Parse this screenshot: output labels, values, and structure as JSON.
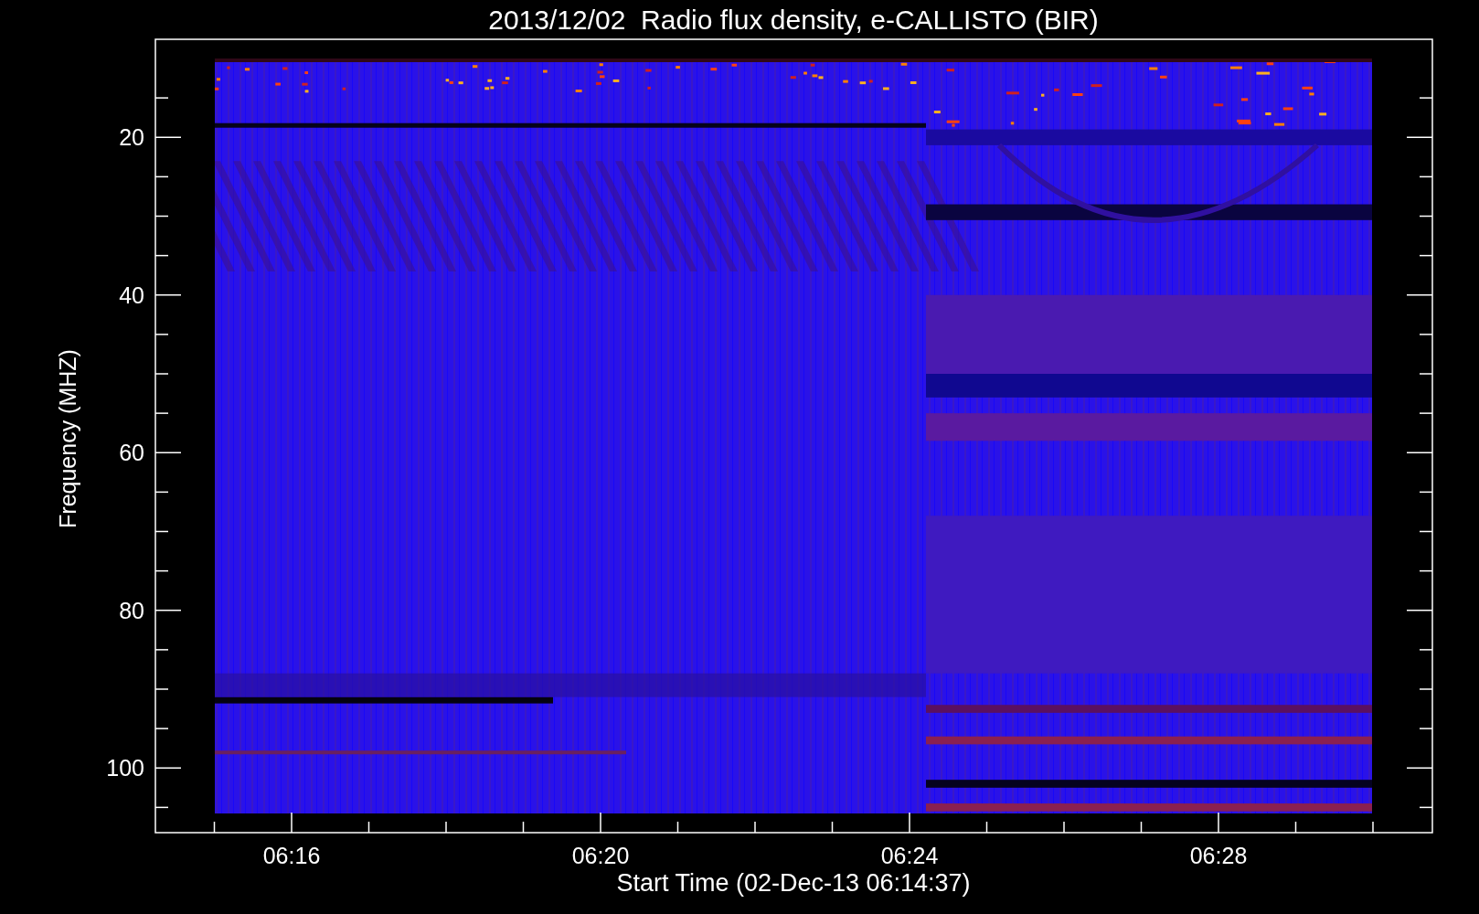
{
  "title": "2013/12/02  Radio flux density, e-CALLISTO (BIR)",
  "y_axis": {
    "label": "Frequency (MHZ)",
    "ticks": [
      "20",
      "40",
      "60",
      "80",
      "100"
    ]
  },
  "x_axis": {
    "label": "Start Time (02-Dec-13 06:14:37)",
    "ticks": [
      "06:16",
      "06:20",
      "06:24",
      "06:28"
    ]
  }
}
